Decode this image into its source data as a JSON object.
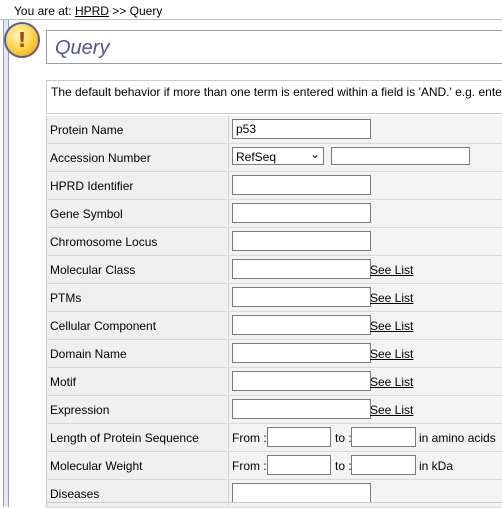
{
  "breadcrumb": {
    "prefix": "You are at: ",
    "home": "HPRD",
    "sep": " >> ",
    "current": "Query"
  },
  "page_title": "Query",
  "info_text": "The default behavior if more than one term is entered within a field is 'AND.' e.g. enter",
  "see_list_label": "See List",
  "from_label": "From :",
  "to_label": "to :",
  "fields": [
    {
      "label": "Protein Name",
      "value": "p53"
    },
    {
      "label": "Accession Number",
      "select_value": "RefSeq",
      "value": ""
    },
    {
      "label": "HPRD Identifier",
      "value": ""
    },
    {
      "label": "Gene Symbol",
      "value": ""
    },
    {
      "label": "Chromosome Locus",
      "value": ""
    },
    {
      "label": "Molecular Class",
      "value": ""
    },
    {
      "label": "PTMs",
      "value": ""
    },
    {
      "label": "Cellular Component",
      "value": ""
    },
    {
      "label": "Domain Name",
      "value": ""
    },
    {
      "label": "Motif",
      "value": ""
    },
    {
      "label": "Expression",
      "value": ""
    },
    {
      "label": "Length of Protein Sequence",
      "unit": "in amino acids"
    },
    {
      "label": "Molecular Weight",
      "unit": "in kDa"
    },
    {
      "label": "Diseases",
      "value": ""
    }
  ],
  "colors": {
    "title": "#555598",
    "border": "#9a9ab8",
    "row_bg": "#efefef"
  },
  "icons": {
    "warning": "exclamation-icon",
    "dropdown": "chevron-down-icon"
  }
}
